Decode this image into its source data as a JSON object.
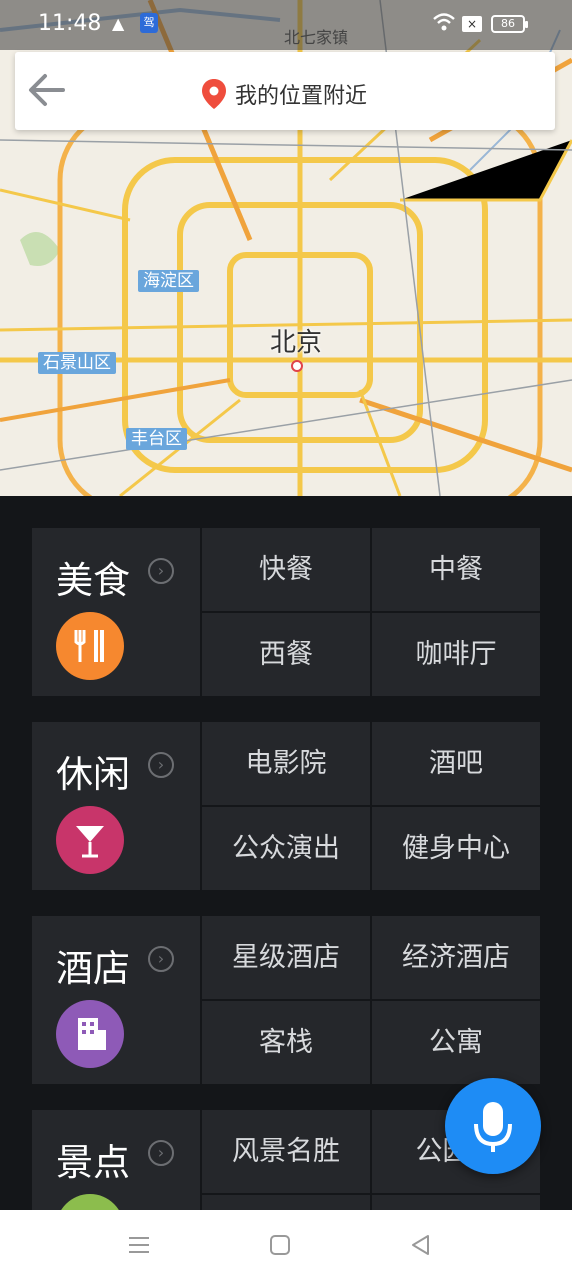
{
  "status_bar": {
    "time": "11:48",
    "warning_glyph": "▲",
    "app_glyph": "驾",
    "xbox_glyph": "×",
    "battery": "86",
    "town": "北七家镇"
  },
  "search": {
    "location_text": "我的位置附近"
  },
  "map": {
    "city": "北京",
    "districts": {
      "haidian": "海淀区",
      "shijingshan": "石景山区",
      "fengtai": "丰台区"
    }
  },
  "categories": [
    {
      "title": "美食",
      "more_glyph": "›",
      "color": "#f6882f",
      "icon": "fork-knife-icon",
      "items": [
        "快餐",
        "中餐",
        "西餐",
        "咖啡厅"
      ]
    },
    {
      "title": "休闲",
      "more_glyph": "›",
      "color": "#c8356a",
      "icon": "cocktail-icon",
      "items": [
        "电影院",
        "酒吧",
        "公众演出",
        "健身中心"
      ]
    },
    {
      "title": "酒店",
      "more_glyph": "›",
      "color": "#8e5ab7",
      "icon": "building-icon",
      "items": [
        "星级酒店",
        "经济酒店",
        "客栈",
        "公寓"
      ]
    },
    {
      "title": "景点",
      "more_glyph": "›",
      "color": "#8cbd4d",
      "icon": "tree-icon",
      "items": [
        "风景名胜",
        "公园广"
      ]
    }
  ],
  "colors": {
    "background": "#141619",
    "cell": "#25272b",
    "accent": "#1e8cf5"
  }
}
